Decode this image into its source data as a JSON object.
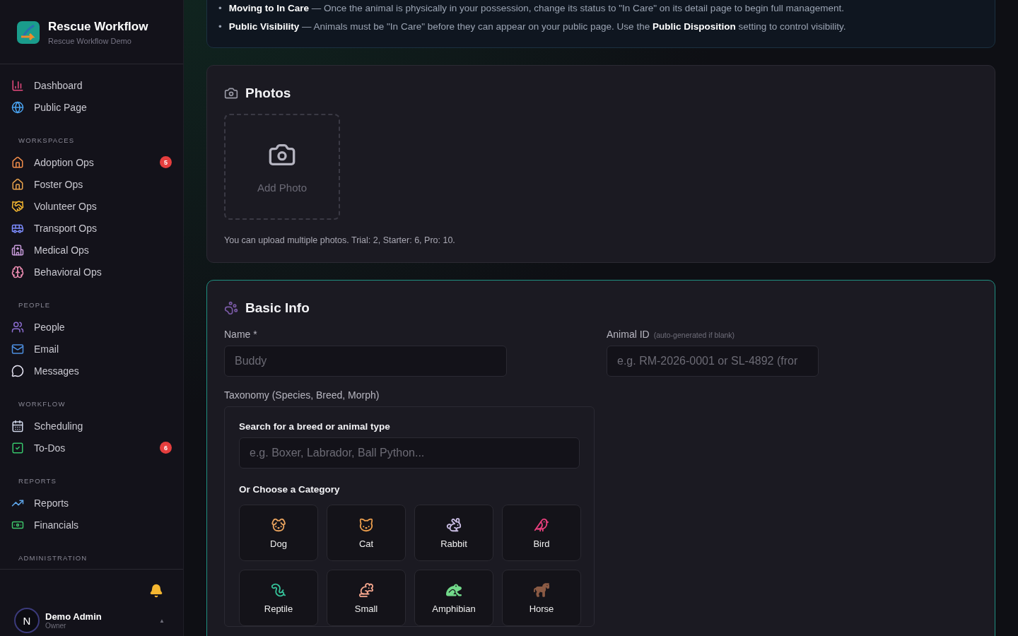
{
  "sidebar": {
    "brand": {
      "title": "Rescue Workflow",
      "subtitle": "Rescue Workflow Demo"
    },
    "top_items": [
      {
        "label": "Dashboard",
        "selected": false
      },
      {
        "label": "Public Page",
        "selected": false
      }
    ],
    "sections": [
      {
        "title": "WORKSPACES",
        "items": [
          {
            "label": "Adoption Ops",
            "badge": "5"
          },
          {
            "label": "Foster Ops"
          },
          {
            "label": "Volunteer Ops"
          },
          {
            "label": "Transport Ops"
          },
          {
            "label": "Medical Ops"
          },
          {
            "label": "Behavioral Ops"
          }
        ]
      },
      {
        "title": "PEOPLE",
        "items": [
          {
            "label": "People"
          },
          {
            "label": "Email"
          },
          {
            "label": "Messages"
          }
        ]
      },
      {
        "title": "WORKFLOW",
        "items": [
          {
            "label": "Scheduling"
          },
          {
            "label": "To-Dos",
            "badge": "6"
          }
        ]
      },
      {
        "title": "REPORTS",
        "items": [
          {
            "label": "Reports"
          },
          {
            "label": "Financials"
          }
        ]
      },
      {
        "title": "ADMINISTRATION"
      }
    ],
    "user": {
      "initial": "N",
      "name": "Demo Admin",
      "role": "Owner",
      "caret": "▲"
    }
  },
  "notice": {
    "bullets": [
      {
        "marker": "•",
        "title": "Moving to In Care",
        "text": "— Once the animal is physically in your possession, change its status to \"In Care\" on its detail page to begin full management."
      },
      {
        "marker": "•",
        "title": "Public Visibility",
        "text": "— Animals must be \"In Care\" before they can appear on your public page. Use the **Public Disposition** setting to control visibility."
      }
    ]
  },
  "photos": {
    "title": "Photos",
    "add_label": "Add Photo",
    "hint": "You can upload multiple photos. Trial: 2, Starter: 6, Pro: 10."
  },
  "basic_info": {
    "title": "Basic Info",
    "name_field": {
      "label": "Name *",
      "placeholder": "Buddy"
    },
    "id_field": {
      "label": "Animal ID",
      "note": "(auto-generated if blank)",
      "placeholder": "e.g. RM-2026-0001 or SL-4892 (fror"
    },
    "taxonomy": {
      "label": "Taxonomy (Species, Breed, Morph)",
      "search_label": "Search for a breed or animal type",
      "search_placeholder": "e.g. Boxer, Labrador, Ball Python...",
      "category_label": "Or Choose a Category",
      "categories": [
        "Dog",
        "Cat",
        "Rabbit",
        "Bird",
        "Reptile",
        "Small",
        "Amphibian",
        "Horse"
      ]
    }
  }
}
